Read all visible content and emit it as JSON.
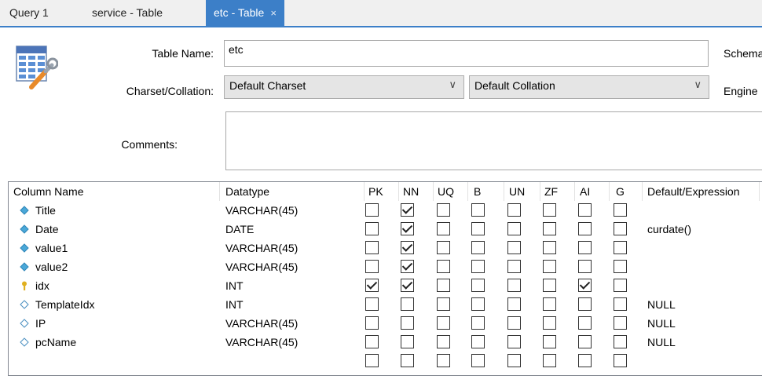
{
  "tabs": [
    {
      "label": "Query 1"
    },
    {
      "label": "service - Table"
    },
    {
      "label": "etc - Table",
      "close": "×"
    }
  ],
  "form": {
    "table_name_label": "Table Name:",
    "table_name_value": "etc",
    "charset_label": "Charset/Collation:",
    "charset_value": "Default Charset",
    "collation_value": "Default Collation",
    "comments_label": "Comments:",
    "comments_value": "",
    "schema_label": "Schema",
    "engine_label": "Engine"
  },
  "grid": {
    "headers": [
      "Column Name",
      "Datatype",
      "PK",
      "NN",
      "UQ",
      "B",
      "UN",
      "ZF",
      "AI",
      "G",
      "Default/Expression"
    ],
    "rows": [
      {
        "name": "Title",
        "type": "VARCHAR(45)",
        "icon": "diamond-filled-icon",
        "flags": [
          false,
          true,
          false,
          false,
          false,
          false,
          false,
          false
        ],
        "default": ""
      },
      {
        "name": "Date",
        "type": "DATE",
        "icon": "diamond-filled-icon",
        "flags": [
          false,
          true,
          false,
          false,
          false,
          false,
          false,
          false
        ],
        "default": "curdate()"
      },
      {
        "name": "value1",
        "type": "VARCHAR(45)",
        "icon": "diamond-filled-icon",
        "flags": [
          false,
          true,
          false,
          false,
          false,
          false,
          false,
          false
        ],
        "default": ""
      },
      {
        "name": "value2",
        "type": "VARCHAR(45)",
        "icon": "diamond-filled-icon",
        "flags": [
          false,
          true,
          false,
          false,
          false,
          false,
          false,
          false
        ],
        "default": ""
      },
      {
        "name": "idx",
        "type": "INT",
        "icon": "key-icon",
        "flags": [
          true,
          true,
          false,
          false,
          false,
          false,
          true,
          false
        ],
        "default": ""
      },
      {
        "name": "TemplateIdx",
        "type": "INT",
        "icon": "diamond-outline-icon",
        "flags": [
          false,
          false,
          false,
          false,
          false,
          false,
          false,
          false
        ],
        "default": "NULL"
      },
      {
        "name": "IP",
        "type": "VARCHAR(45)",
        "icon": "diamond-outline-icon",
        "flags": [
          false,
          false,
          false,
          false,
          false,
          false,
          false,
          false
        ],
        "default": "NULL"
      },
      {
        "name": "pcName",
        "type": "VARCHAR(45)",
        "icon": "diamond-outline-icon",
        "flags": [
          false,
          false,
          false,
          false,
          false,
          false,
          false,
          false
        ],
        "default": "NULL"
      },
      {
        "name": "",
        "type": "",
        "icon": "",
        "flags": [
          false,
          false,
          false,
          false,
          false,
          false,
          false,
          false
        ],
        "default": ""
      }
    ]
  },
  "colors": {
    "accent": "#3c7fc8",
    "diamond": "#4aa8d8",
    "key": "#e0b020"
  }
}
